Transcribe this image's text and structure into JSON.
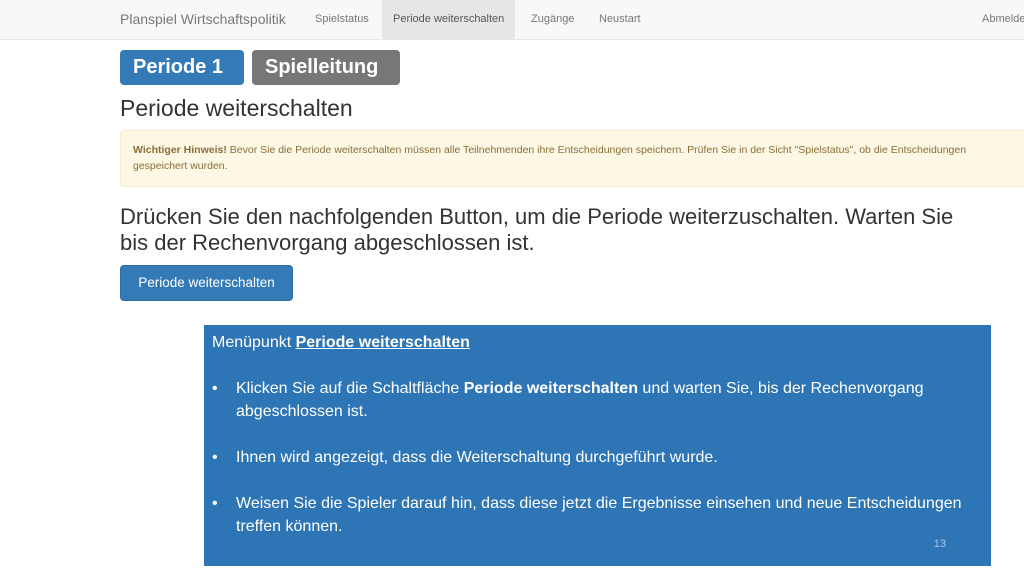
{
  "navbar": {
    "brand": "Planspiel Wirtschaftspolitik",
    "items": [
      {
        "label": "Spielstatus",
        "active": false
      },
      {
        "label": "Periode weiterschalten",
        "active": true
      },
      {
        "label": "Zugänge",
        "active": false
      },
      {
        "label": "Neustart",
        "active": false
      }
    ],
    "logout": "Abmelde"
  },
  "badges": {
    "period": "Periode 1",
    "role": "Spielleitung"
  },
  "page_title": "Periode weiterschalten",
  "alert": {
    "strong": "Wichtiger Hinweis!",
    "text": " Bevor Sie die Periode weiterschalten müssen alle Teilnehmenden ihre Entscheidungen speichern. Prüfen Sie in der Sicht \"Spielstatus\", ob die Entscheidungen gespeichert wurden."
  },
  "instruction": {
    "line1": "Drücken Sie den nachfolgenden Button, um die Periode weiterzuschalten. Warten Sie",
    "line2": "bis der Rechenvorgang abgeschlossen ist."
  },
  "action_button": "Periode weiterschalten",
  "callout": {
    "title_prefix": "Menüpunkt ",
    "title_link": "Periode weiterschalten",
    "bullet_char": "•",
    "bullet1_pre": "Klicken Sie auf die Schaltfläche ",
    "bullet1_bold": "Periode weiterschalten",
    "bullet1_post": " und warten Sie, bis der Rechenvorgang abgeschlossen ist.",
    "bullet2": "Ihnen wird angezeigt, dass die Weiterschaltung durchgeführt wurde.",
    "bullet3": "Weisen Sie die Spieler darauf hin, dass diese jetzt die Ergebnisse einsehen und neue Entscheidungen treffen können.",
    "slide_number": "13"
  },
  "colors": {
    "primary": "#337ab7",
    "badge_gray": "#777777",
    "alert_bg": "#fcf8e3",
    "alert_text": "#8a6d3b",
    "callout_bg": "#2e75b6"
  }
}
